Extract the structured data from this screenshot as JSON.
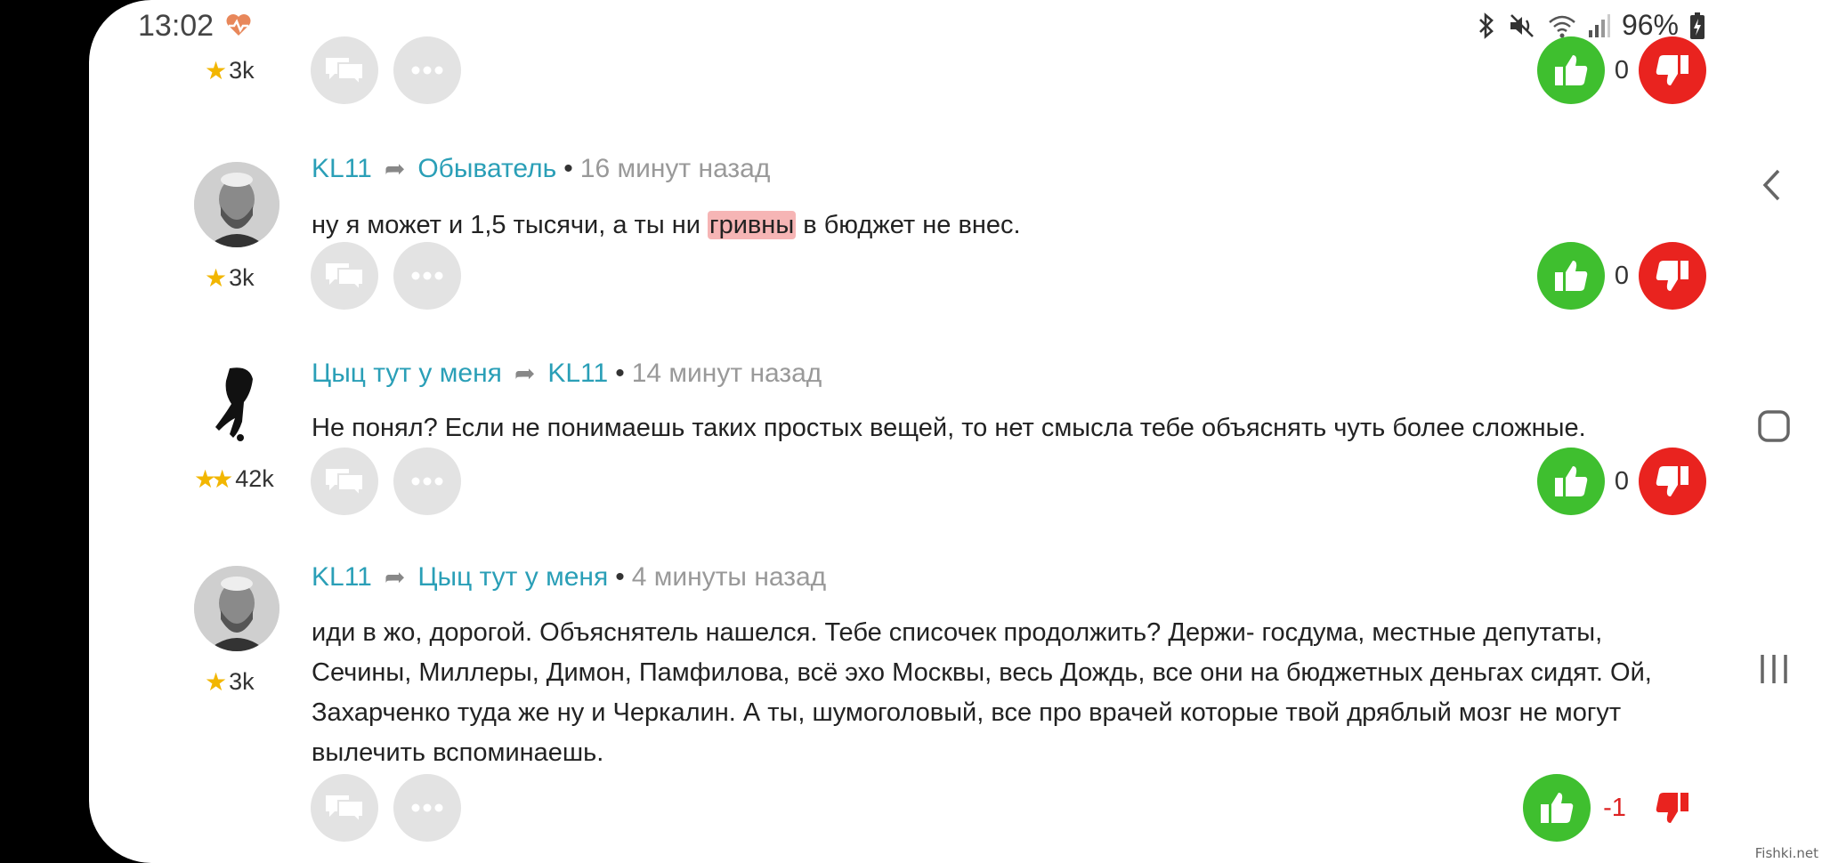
{
  "status_bar": {
    "time": "13:02",
    "battery": "96%"
  },
  "top_partial": {
    "rating": "3k",
    "score": "0"
  },
  "comments": [
    {
      "author": "KL11",
      "reply_to": "Обыватель",
      "time_ago": "16 минут назад",
      "text_before": "ну я может и 1,5 тысячи, а ты ни ",
      "text_highlight": "гривны",
      "text_after": " в бюджет не внес.",
      "rating": "3k",
      "score": "0"
    },
    {
      "author": "Цыц тут у меня",
      "reply_to": "KL11",
      "time_ago": "14 минут назад",
      "text": "Не понял? Если не понимаешь таких простых вещей, то нет смысла тебе объяснять чуть более сложные.",
      "rating": "42k",
      "score": "0"
    },
    {
      "author": "KL11",
      "reply_to": "Цыц тут у меня",
      "time_ago": "4 минуты назад",
      "text": "иди в жо, дорогой. Объяснятель нашелся. Тебе списочек продолжить? Держи- госдума, местные депутаты, Сечины, Миллеры, Димон, Памфилова, всё эхо Москвы, весь Дождь, все они на бюджетных деньгах сидят. Ой, Захарченко туда же ну и Черкалин. А ты, шумоголовый, все про врачей которые твой дряблый мозг не могут вылечить вспоминаешь.",
      "rating": "3k",
      "score": "-1"
    }
  ],
  "watermark": "Fishki.net",
  "colors": {
    "link": "#2a9fb7",
    "upvote": "#3fbf2f",
    "downvote": "#e9231f",
    "star": "#f2b600"
  }
}
